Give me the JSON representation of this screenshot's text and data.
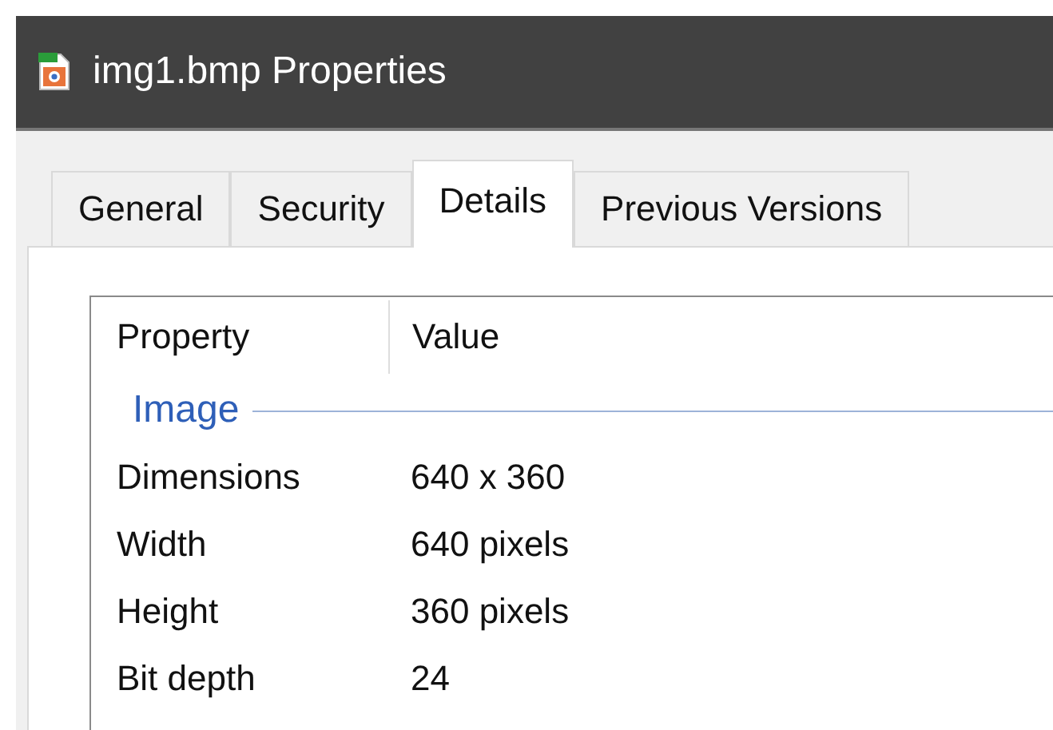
{
  "window": {
    "title": "img1.bmp Properties"
  },
  "tabs": [
    {
      "label": "General",
      "selected": false
    },
    {
      "label": "Security",
      "selected": false
    },
    {
      "label": "Details",
      "selected": true
    },
    {
      "label": "Previous Versions",
      "selected": false
    }
  ],
  "table": {
    "columns": [
      "Property",
      "Value"
    ],
    "groups": [
      {
        "label": "Image",
        "rows": [
          {
            "property": "Dimensions",
            "value": "640 x 360"
          },
          {
            "property": "Width",
            "value": "640 pixels"
          },
          {
            "property": "Height",
            "value": "360 pixels"
          },
          {
            "property": "Bit depth",
            "value": "24"
          }
        ]
      }
    ]
  }
}
